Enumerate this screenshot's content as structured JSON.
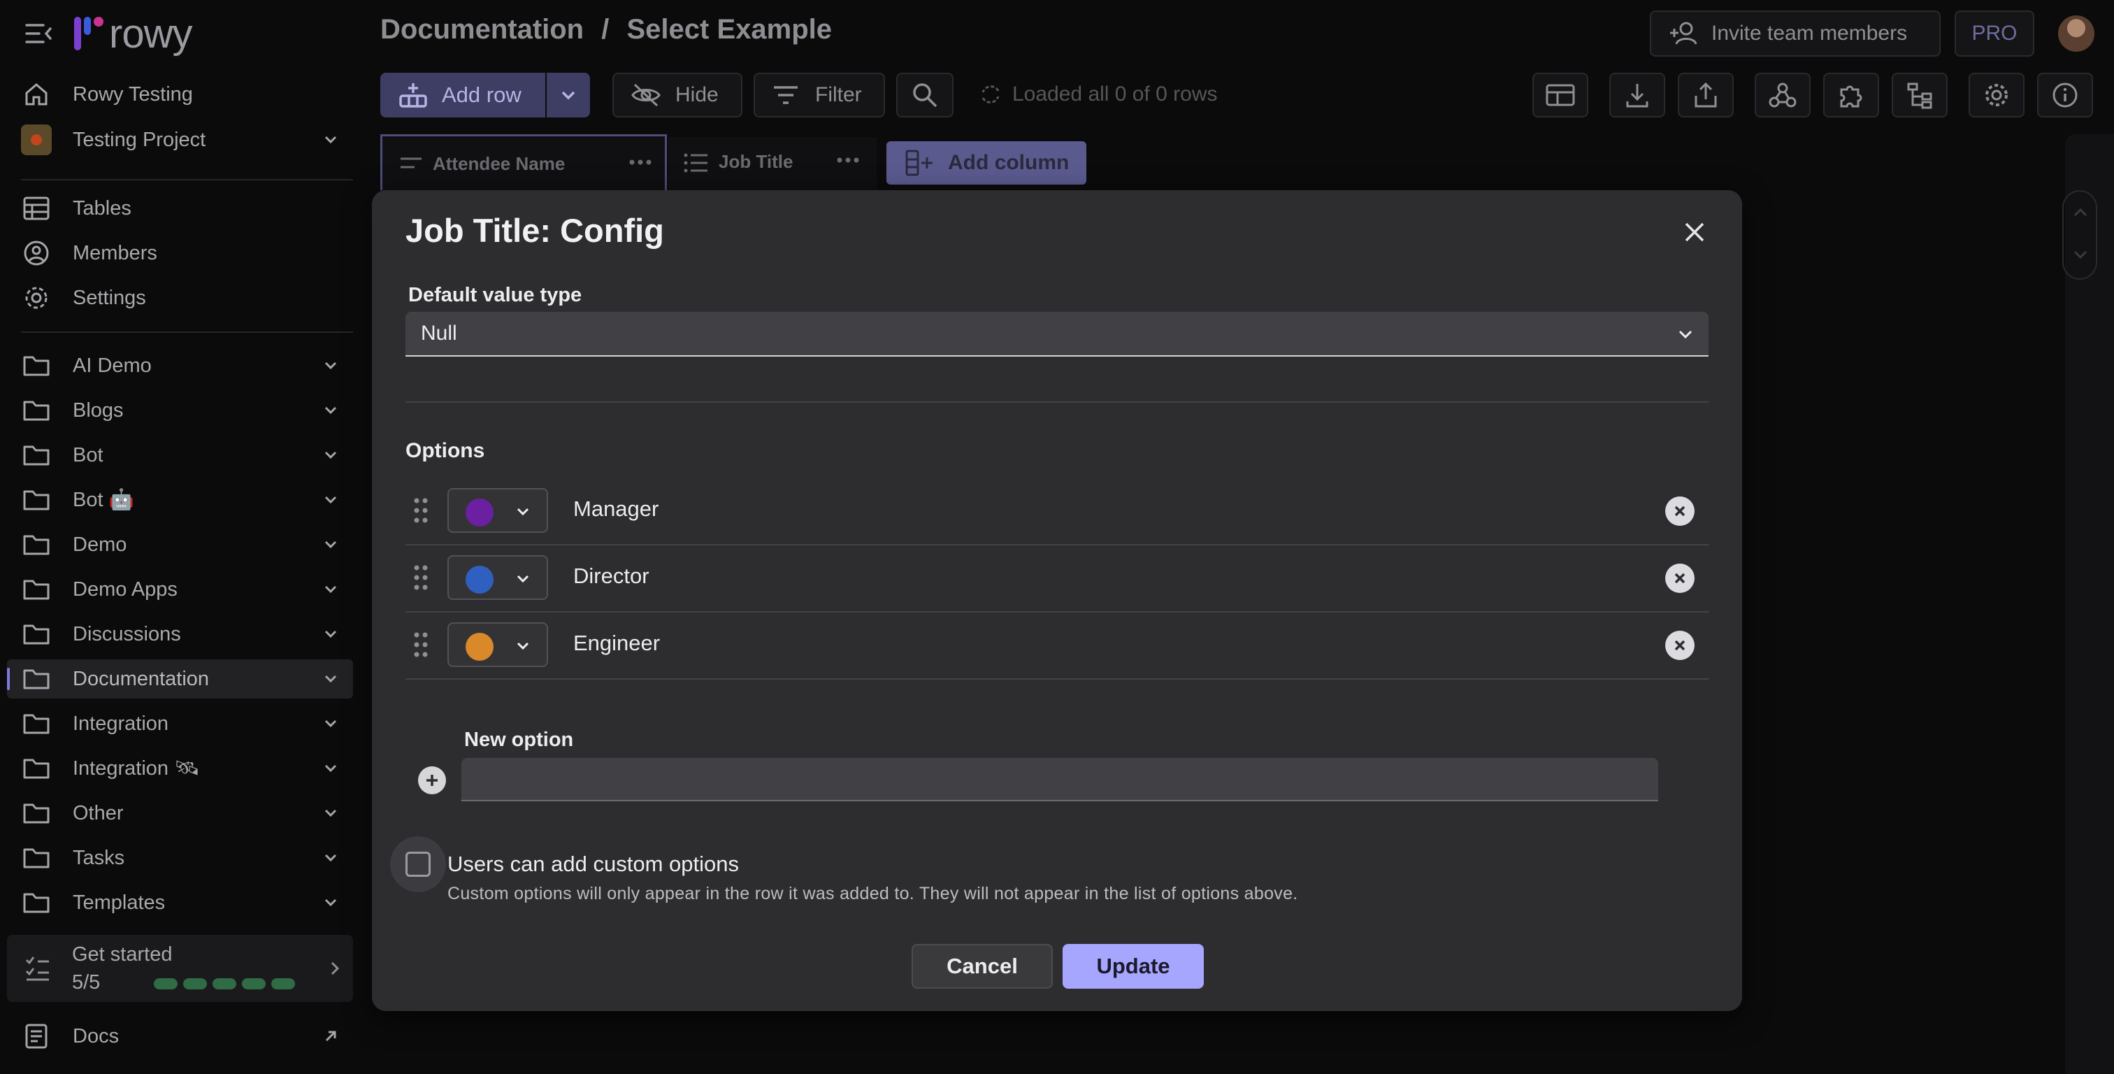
{
  "app": {
    "logo_text": "rowy",
    "menu_icon": "menu-collapse-icon"
  },
  "sidebar": {
    "workspace": "Rowy Testing",
    "project": "Testing Project",
    "nav": [
      {
        "label": "Tables",
        "icon": "tables-icon"
      },
      {
        "label": "Members",
        "icon": "members-icon"
      },
      {
        "label": "Settings",
        "icon": "settings-icon"
      }
    ],
    "folders": [
      {
        "label": "AI Demo"
      },
      {
        "label": "Blogs"
      },
      {
        "label": "Bot"
      },
      {
        "label": "Bot 🤖"
      },
      {
        "label": "Demo"
      },
      {
        "label": "Demo Apps"
      },
      {
        "label": "Discussions"
      },
      {
        "label": "Documentation",
        "active": true
      },
      {
        "label": "Integration"
      },
      {
        "label": "Integration 🛰"
      },
      {
        "label": "Other"
      },
      {
        "label": "Tasks"
      },
      {
        "label": "Templates"
      }
    ],
    "get_started": {
      "label": "Get started",
      "progress_text": "5/5",
      "steps_done": 5,
      "steps_total": 5
    },
    "docs": "Docs"
  },
  "header": {
    "breadcrumb_section": "Documentation",
    "breadcrumb_sep": "/",
    "breadcrumb_page": "Select Example",
    "invite_label": "Invite team members",
    "pro_badge": "PRO"
  },
  "toolbar": {
    "add_row": "Add row",
    "hide": "Hide",
    "filter": "Filter",
    "loaded_status": "Loaded all 0 of 0 rows"
  },
  "columns": [
    {
      "label": "Attendee Name",
      "icon": "short-text-icon"
    },
    {
      "label": "Job Title",
      "icon": "single-select-icon"
    }
  ],
  "add_column": "Add column",
  "dialog": {
    "title": "Job Title: Config",
    "default_value_type_label": "Default value type",
    "default_value_type_value": "Null",
    "options_heading": "Options",
    "options": [
      {
        "label": "Manager",
        "color": "#6b1fa1"
      },
      {
        "label": "Director",
        "color": "#2f5fbf"
      },
      {
        "label": "Engineer",
        "color": "#d9882a"
      }
    ],
    "new_option_label": "New option",
    "new_option_value": "",
    "custom_options_label": "Users can add custom options",
    "custom_options_help": "Custom options will only appear in the row it was added to. They will not appear in the list of options above.",
    "cancel": "Cancel",
    "update": "Update"
  },
  "colors": {
    "accent": "#a7a6ff",
    "get_started_bar": "#2f6b45",
    "active_indicator": "#7c7bd9"
  }
}
